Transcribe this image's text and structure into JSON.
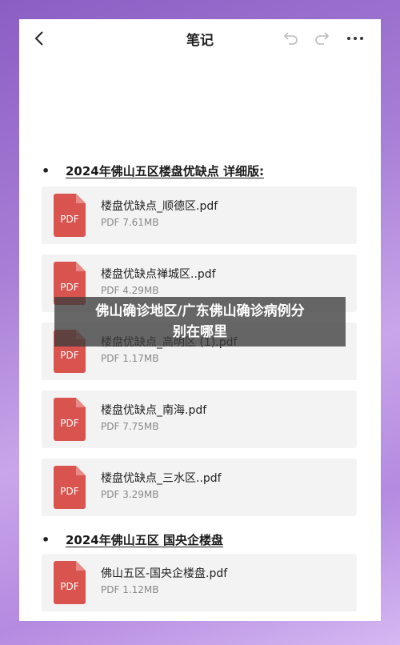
{
  "header": {
    "title": "笔记"
  },
  "sections": [
    {
      "bullet": "•",
      "title": "2024年佛山五区楼盘优缺点 详细版:",
      "files": [
        {
          "name": "楼盘优缺点_顺德区.pdf",
          "size": "PDF 7.61MB",
          "type": "PDF"
        },
        {
          "name": "楼盘优缺点禅城区..pdf",
          "size": "PDF 4.29MB",
          "type": "PDF"
        },
        {
          "name": "楼盘优缺点_高明区 (1).pdf",
          "size": "PDF 1.17MB",
          "type": "PDF"
        },
        {
          "name": "楼盘优缺点_南海.pdf",
          "size": "PDF 7.75MB",
          "type": "PDF"
        },
        {
          "name": "楼盘优缺点_三水区..pdf",
          "size": "PDF 3.29MB",
          "type": "PDF"
        }
      ]
    },
    {
      "bullet": "•",
      "title": "2024年佛山五区 国央企楼盘",
      "files": [
        {
          "name": "佛山五区-国央企楼盘.pdf",
          "size": "PDF 1.12MB",
          "type": "PDF"
        }
      ]
    }
  ],
  "overlay": {
    "line1": "佛山确诊地区/广东佛山确诊病例分",
    "line2": "别在哪里"
  },
  "colors": {
    "pdf_red": "#d9534f",
    "background_purple": "#a77fd6"
  }
}
